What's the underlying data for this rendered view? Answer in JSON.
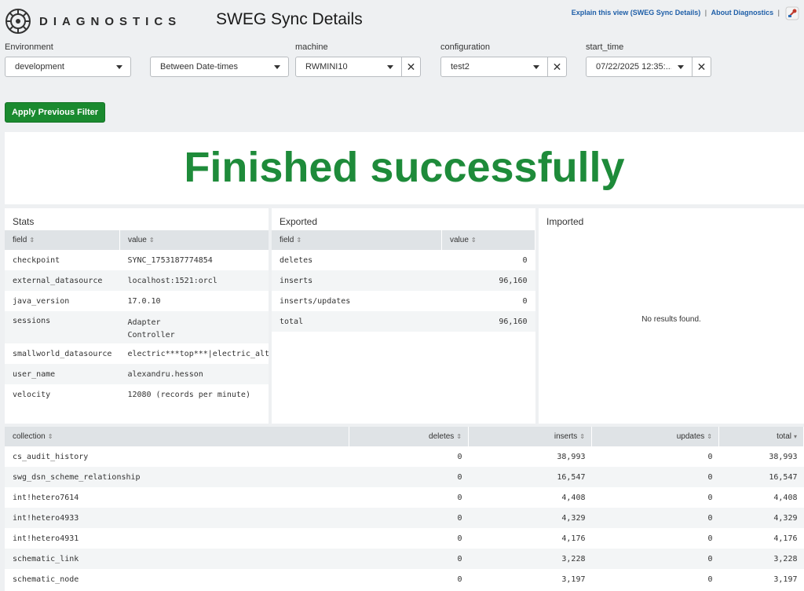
{
  "header": {
    "logo_text": "DIAGNOSTICS",
    "title": "SWEG Sync Details",
    "link_explain": "Explain this view (SWEG Sync Details)",
    "link_about": "About Diagnostics",
    "separator": "|"
  },
  "filters": {
    "environment": {
      "label": "Environment",
      "value": "development"
    },
    "time_range": {
      "value": "Between Date-times"
    },
    "machine": {
      "label": "machine",
      "value": "RWMINI10"
    },
    "configuration": {
      "label": "configuration",
      "value": "test2"
    },
    "start_time": {
      "label": "start_time",
      "value": "07/22/2025 12:35:..."
    },
    "clear_symbol": "✕"
  },
  "apply_button": "Apply Previous Filter",
  "status": {
    "text": "Finished successfully",
    "color": "#1e8b3a"
  },
  "stats": {
    "title": "Stats",
    "columns": [
      "field",
      "value"
    ],
    "rows": [
      {
        "field": "checkpoint",
        "value": "SYNC_1753187774854"
      },
      {
        "field": "external_datasource",
        "value": "localhost:1521:orcl"
      },
      {
        "field": "java_version",
        "value": "17.0.10"
      },
      {
        "field": "sessions",
        "value": "Adapter",
        "value2": "Controller"
      },
      {
        "field": "smallworld_datasource",
        "value": "electric***top***|electric_alt"
      },
      {
        "field": "user_name",
        "value": "alexandru.hesson"
      },
      {
        "field": "velocity",
        "value": "12080 (records per minute)"
      }
    ]
  },
  "exported": {
    "title": "Exported",
    "columns": [
      "field",
      "value"
    ],
    "rows": [
      {
        "field": "deletes",
        "value": "0"
      },
      {
        "field": "inserts",
        "value": "96,160"
      },
      {
        "field": "inserts/updates",
        "value": "0"
      },
      {
        "field": "total",
        "value": "96,160"
      }
    ]
  },
  "imported": {
    "title": "Imported",
    "empty_text": "No results found."
  },
  "collections": {
    "columns": [
      "collection",
      "deletes",
      "inserts",
      "updates",
      "total"
    ],
    "rows": [
      {
        "collection": "cs_audit_history",
        "deletes": "0",
        "inserts": "38,993",
        "updates": "0",
        "total": "38,993"
      },
      {
        "collection": "swg_dsn_scheme_relationship",
        "deletes": "0",
        "inserts": "16,547",
        "updates": "0",
        "total": "16,547"
      },
      {
        "collection": "int!hetero7614",
        "deletes": "0",
        "inserts": "4,408",
        "updates": "0",
        "total": "4,408"
      },
      {
        "collection": "int!hetero4933",
        "deletes": "0",
        "inserts": "4,329",
        "updates": "0",
        "total": "4,329"
      },
      {
        "collection": "int!hetero4931",
        "deletes": "0",
        "inserts": "4,176",
        "updates": "0",
        "total": "4,176"
      },
      {
        "collection": "schematic_link",
        "deletes": "0",
        "inserts": "3,228",
        "updates": "0",
        "total": "3,228"
      },
      {
        "collection": "schematic_node",
        "deletes": "0",
        "inserts": "3,197",
        "updates": "0",
        "total": "3,197"
      }
    ]
  }
}
